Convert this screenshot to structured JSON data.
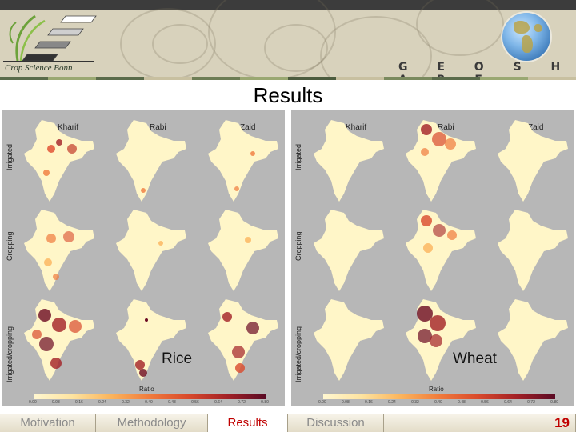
{
  "header": {
    "logo_text": "Crop Science Bonn",
    "brand": "G E O S H A R E"
  },
  "slide": {
    "title": "Results",
    "page_number": "19"
  },
  "figures": [
    {
      "crop": "Rice",
      "columns": [
        "Kharif",
        "Rabi",
        "Zaid"
      ],
      "rows": [
        "Irrigated",
        "Cropping",
        "Irrigated/cropping"
      ],
      "legend_title": "Ratio",
      "legend_ticks": [
        "0.00",
        "0.08",
        "0.16",
        "0.24",
        "0.32",
        "0.40",
        "0.48",
        "0.56",
        "0.64",
        "0.72",
        "0.80"
      ]
    },
    {
      "crop": "Wheat",
      "columns": [
        "Kharif",
        "Rabi",
        "Zaid"
      ],
      "rows": [
        "Irrigated",
        "Cropping",
        "Irrigated/cropping"
      ],
      "legend_title": "Ratio",
      "legend_ticks": [
        "0.00",
        "0.08",
        "0.16",
        "0.24",
        "0.32",
        "0.40",
        "0.48",
        "0.56",
        "0.64",
        "0.72",
        "0.80"
      ]
    }
  ],
  "nav": {
    "tabs": [
      {
        "label": "Motivation"
      },
      {
        "label": "Methodology"
      },
      {
        "label": "Results"
      },
      {
        "label": "Discussion"
      },
      {
        "label": ""
      }
    ]
  },
  "colors": {
    "accent": "#c00000",
    "panel_bg": "#b7b7b7",
    "map_base": "#fff6c8",
    "heat_low": "#f3a45a",
    "heat_high": "#6b0a22"
  }
}
